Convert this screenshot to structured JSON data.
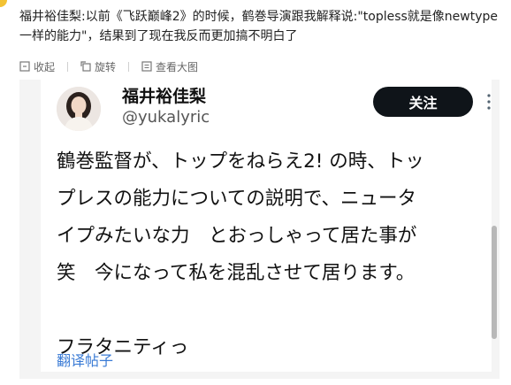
{
  "post": {
    "text": "福井裕佳梨:以前《飞跃巅峰2》的时候，鹤巻导演跟我解释说:\"topless就是像newtype一样的能力\"，结果到了现在我反而更加搞不明白了"
  },
  "toolbar": {
    "collapse_label": "收起",
    "rotate_label": "旋转",
    "view_large_label": "查看大图"
  },
  "tweet": {
    "author_name": "福井裕佳梨",
    "author_handle": "@yukalyric",
    "follow_label": "关注",
    "body": "鶴巻監督が、トップをねらえ2! の時、トッ\nプレスの能力についての説明で、ニュータ\nイプみたいな力　とおっしゃって居た事が\n笑　今になって私を混乱させて居ります。\n\nフラタニティっ",
    "translate_label": "翻译帖子"
  },
  "colors": {
    "follow_button_bg": "#0f1419",
    "link_blue": "#3a7bd5",
    "panel_bg": "#f4f4f4"
  },
  "icons": [
    "collapse-icon",
    "rotate-icon",
    "view-large-icon",
    "more-options-icon",
    "avatar"
  ]
}
